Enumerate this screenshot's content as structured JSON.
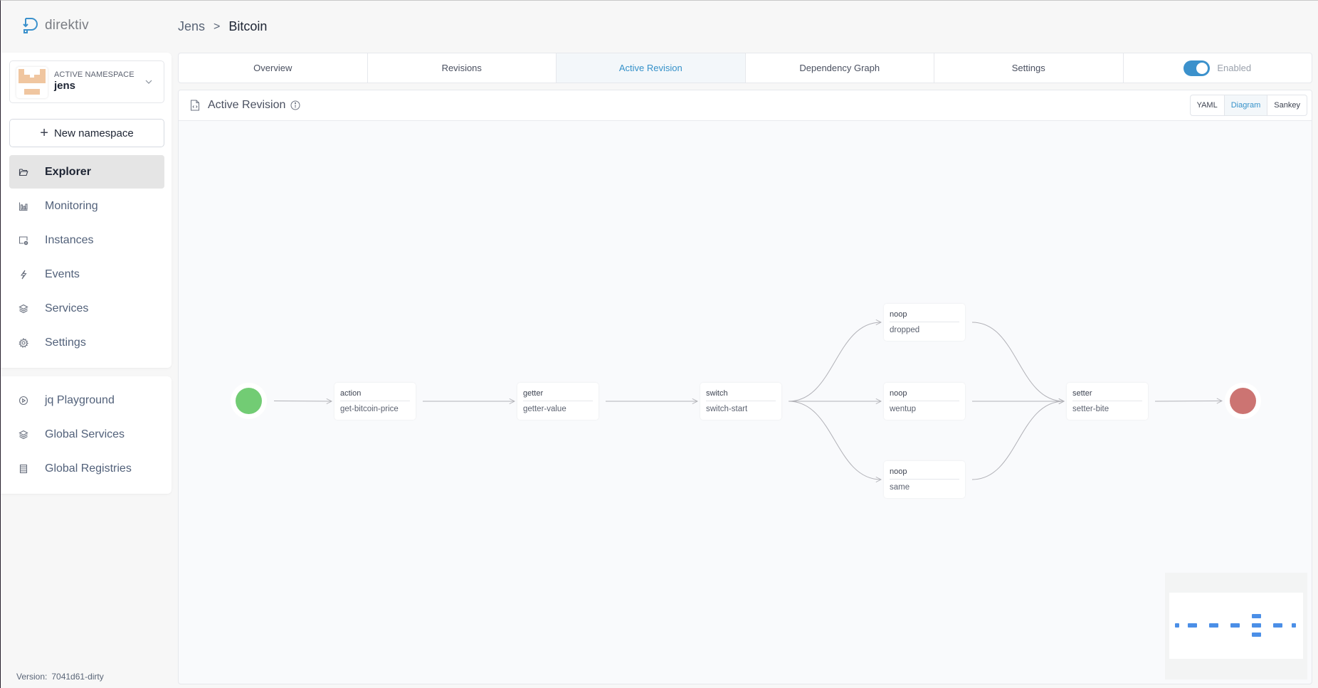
{
  "app": {
    "logo_text": "direktiv",
    "brand_color": "#3b91cc"
  },
  "sidebar": {
    "namespace_label": "ACTIVE NAMESPACE",
    "namespace_name": "jens",
    "new_namespace_label": "New namespace",
    "items": [
      {
        "label": "Explorer",
        "icon": "folder-open-icon",
        "active": true
      },
      {
        "label": "Monitoring",
        "icon": "bar-chart-icon",
        "active": false
      },
      {
        "label": "Instances",
        "icon": "monitor-play-icon",
        "active": false
      },
      {
        "label": "Events",
        "icon": "lightning-icon",
        "active": false
      },
      {
        "label": "Services",
        "icon": "layers-icon",
        "active": false
      },
      {
        "label": "Settings",
        "icon": "gear-icon",
        "active": false
      }
    ],
    "global_items": [
      {
        "label": "jq Playground",
        "icon": "play-circle-icon"
      },
      {
        "label": "Global Services",
        "icon": "layers-icon"
      },
      {
        "label": "Global Registries",
        "icon": "server-icon"
      }
    ],
    "version_label": "Version:",
    "version_value": "7041d61-dirty"
  },
  "breadcrumb": {
    "parent": "Jens",
    "separator": ">",
    "current": "Bitcoin"
  },
  "tabs": [
    {
      "label": "Overview",
      "active": false
    },
    {
      "label": "Revisions",
      "active": false
    },
    {
      "label": "Active Revision",
      "active": true
    },
    {
      "label": "Dependency Graph",
      "active": false
    },
    {
      "label": "Settings",
      "active": false
    }
  ],
  "toggle": {
    "label": "Enabled",
    "on": true
  },
  "panel": {
    "title": "Active Revision",
    "views": [
      {
        "label": "YAML",
        "active": false
      },
      {
        "label": "Diagram",
        "active": true
      },
      {
        "label": "Sankey",
        "active": false
      }
    ]
  },
  "diagram": {
    "start_color": "#72cc74",
    "end_color": "#cc7472",
    "nodes": [
      {
        "id": "get-bitcoin-price",
        "type": "action",
        "name": "get-bitcoin-price"
      },
      {
        "id": "getter-value",
        "type": "getter",
        "name": "getter-value"
      },
      {
        "id": "switch-start",
        "type": "switch",
        "name": "switch-start"
      },
      {
        "id": "dropped",
        "type": "noop",
        "name": "dropped"
      },
      {
        "id": "wentup",
        "type": "noop",
        "name": "wentup"
      },
      {
        "id": "same",
        "type": "noop",
        "name": "same"
      },
      {
        "id": "setter-bite",
        "type": "setter",
        "name": "setter-bite"
      }
    ],
    "edges": [
      [
        "start",
        "get-bitcoin-price"
      ],
      [
        "get-bitcoin-price",
        "getter-value"
      ],
      [
        "getter-value",
        "switch-start"
      ],
      [
        "switch-start",
        "dropped"
      ],
      [
        "switch-start",
        "wentup"
      ],
      [
        "switch-start",
        "same"
      ],
      [
        "dropped",
        "setter-bite"
      ],
      [
        "wentup",
        "setter-bite"
      ],
      [
        "same",
        "setter-bite"
      ],
      [
        "setter-bite",
        "end"
      ]
    ]
  }
}
